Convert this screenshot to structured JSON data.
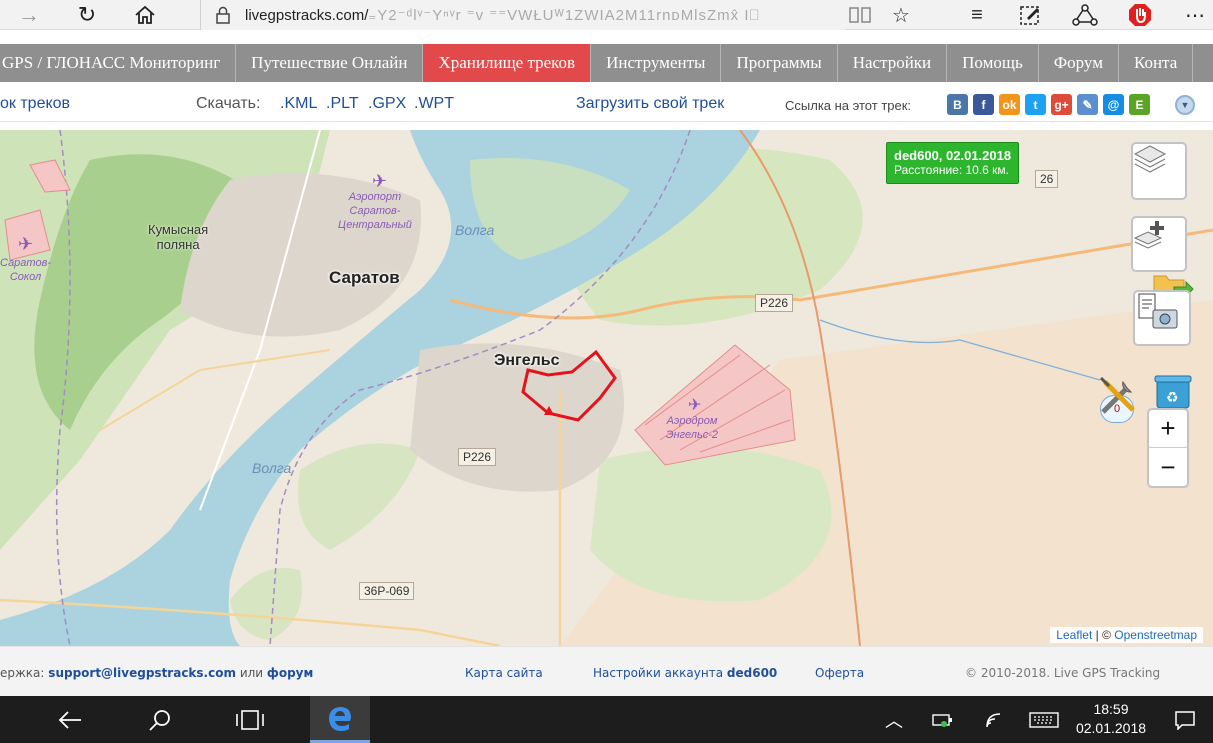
{
  "browser": {
    "url_host": "livegpstracks.com/",
    "url_rest": "₌Y2⁻ᵈlᵛ⁻Yⁿᵛr ⁼v  ⁼⁼VWŁUᵂ1ZWIA2M11rnᴅMlsZmx̂ I⃓"
  },
  "nav": {
    "items": [
      {
        "label": "GPS / ГЛОНАСС Мониторинг"
      },
      {
        "label": "Путешествие Онлайн"
      },
      {
        "label": "Хранилище треков",
        "active": true
      },
      {
        "label": "Инструменты"
      },
      {
        "label": "Программы"
      },
      {
        "label": "Настройки"
      },
      {
        "label": "Помощь"
      },
      {
        "label": "Форум"
      },
      {
        "label": "Конта"
      }
    ]
  },
  "subbar": {
    "track_list": "ок треков",
    "download_label": "Скачать:",
    "formats": [
      ".KML",
      ".PLT",
      ".GPX",
      ".WPT"
    ],
    "upload_link": "Загрузить свой трек",
    "share_label": "Ссылка на этот трек:",
    "share_icons": [
      {
        "name": "vk",
        "glyph": "B",
        "color": "#4a76a8"
      },
      {
        "name": "facebook",
        "glyph": "f",
        "color": "#3b5998"
      },
      {
        "name": "odnoklassniki",
        "glyph": "ok",
        "color": "#f2951b"
      },
      {
        "name": "twitter",
        "glyph": "t",
        "color": "#1da1f2"
      },
      {
        "name": "google-plus",
        "glyph": "g+",
        "color": "#dd4b39"
      },
      {
        "name": "livejournal",
        "glyph": "✎",
        "color": "#5c8fcf"
      },
      {
        "name": "mailru",
        "glyph": "@",
        "color": "#168de2"
      },
      {
        "name": "evernote",
        "glyph": "E",
        "color": "#5ba525"
      }
    ]
  },
  "map": {
    "labels": {
      "saratov": "Саратов",
      "engels": "Энгельс",
      "volga_1": "Волга",
      "volga_2": "Волга",
      "kumysnaya": "Кумысная\nполяна",
      "airport_central": "Аэропорт\nСаратов-\nЦентральный",
      "airport_sokol": "Саратов-\nСокол",
      "airfield_engels": "Аэродром\nЭнгельс-2"
    },
    "roads": {
      "r226_a": "Р226",
      "r226_b": "Р226",
      "r226_c": "26",
      "r36": "36Р-069"
    },
    "popup_title": "ded600, 02.01.2018",
    "popup_distance": "Расстояние: 10.6 км.",
    "comment_count": "0",
    "zoom_in": "+",
    "zoom_out": "−",
    "attribution_leaflet": "Leaflet",
    "attribution_sep": " | © ",
    "attribution_osm": "Openstreetmap"
  },
  "footer": {
    "support_prefix": "ержка:",
    "support_email": "support@livegpstracks.com",
    "or": "или",
    "forum": "форум",
    "sitemap": "Карта сайта",
    "account_prefix": "Настройки аккаунта",
    "account_user": "ded600",
    "offer": "Оферта",
    "copyright": "© 2010-2018. Live GPS Tracking"
  },
  "taskbar": {
    "time": "18:59",
    "date": "02.01.2018"
  }
}
